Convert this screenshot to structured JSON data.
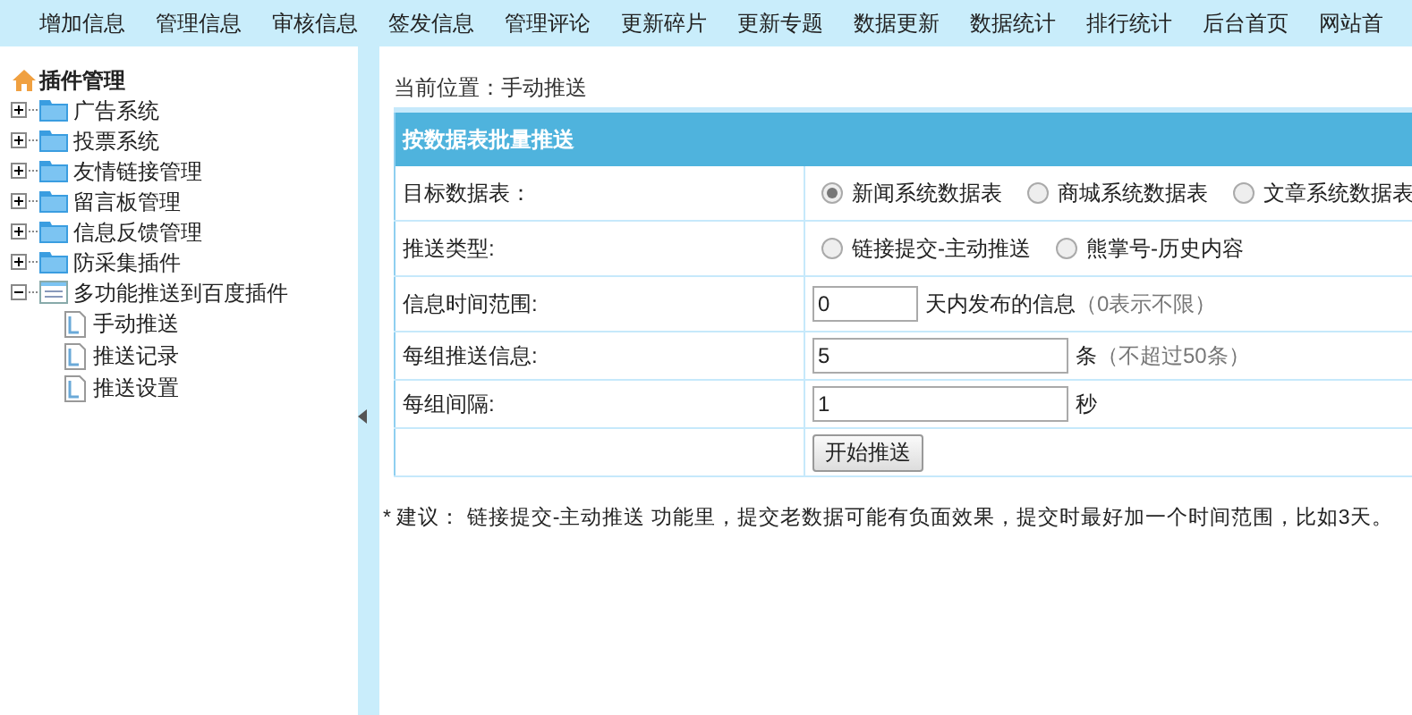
{
  "top_nav": [
    "增加信息",
    "管理信息",
    "审核信息",
    "签发信息",
    "管理评论",
    "更新碎片",
    "更新专题",
    "数据更新",
    "数据统计",
    "排行统计",
    "后台首页",
    "网站首"
  ],
  "sidebar": {
    "title": "插件管理",
    "items": [
      {
        "label": "广告系统",
        "expanded": false
      },
      {
        "label": "投票系统",
        "expanded": false
      },
      {
        "label": "友情链接管理",
        "expanded": false
      },
      {
        "label": "留言板管理",
        "expanded": false
      },
      {
        "label": "信息反馈管理",
        "expanded": false
      },
      {
        "label": "防采集插件",
        "expanded": false
      },
      {
        "label": "多功能推送到百度插件",
        "expanded": true,
        "children": [
          {
            "label": "手动推送"
          },
          {
            "label": "推送记录"
          },
          {
            "label": "推送设置"
          }
        ]
      }
    ]
  },
  "breadcrumb": "当前位置：手动推送",
  "form": {
    "title": "按数据表批量推送",
    "rows": [
      {
        "kind": "radio",
        "label": "目标数据表：",
        "options": [
          {
            "label": "新闻系统数据表",
            "selected": true
          },
          {
            "label": "商城系统数据表",
            "selected": false
          },
          {
            "label": "文章系统数据表",
            "selected": false
          }
        ]
      },
      {
        "kind": "radio",
        "label": "推送类型:",
        "options": [
          {
            "label": "链接提交-主动推送",
            "selected": false
          },
          {
            "label": "熊掌号-历史内容",
            "selected": false
          }
        ]
      },
      {
        "kind": "shortfield",
        "label": "信息时间范围:",
        "value": "0",
        "unit": "天内发布的信息",
        "hint": "（0表示不限）"
      },
      {
        "kind": "field",
        "label": "每组推送信息:",
        "value": "5",
        "unit": "条",
        "hint": "（不超过50条）"
      },
      {
        "kind": "field",
        "label": "每组间隔:",
        "value": "1",
        "unit": "秒"
      },
      {
        "kind": "button",
        "label": "开始推送"
      }
    ]
  },
  "note": "* 建议： 链接提交-主动推送 功能里，提交老数据可能有负面效果，提交时最好加一个时间范围，比如3天。"
}
